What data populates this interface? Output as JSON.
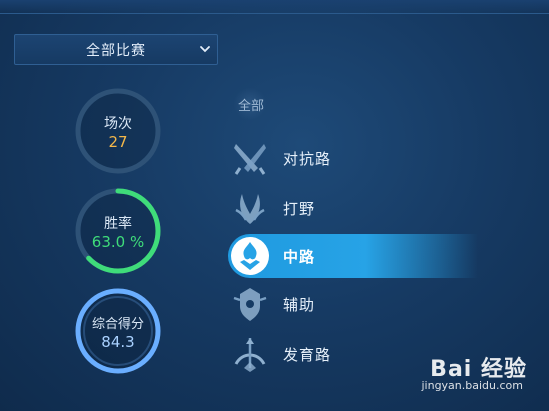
{
  "colors": {
    "accent_blue": "#27a3e6",
    "win_green": "#3fdc7a",
    "matches_orange": "#f3b74a",
    "score_blue": "#6aaeff",
    "text": "#e6f0fa"
  },
  "filter": {
    "selected": "全部比赛"
  },
  "stats": {
    "matches": {
      "label": "场次",
      "value": "27"
    },
    "win_rate": {
      "label": "胜率",
      "value": "63.0 %",
      "fraction": 0.63
    },
    "score": {
      "label": "综合得分",
      "value": "84.3"
    }
  },
  "roles": {
    "all_label": "全部",
    "items": [
      {
        "label": "对抗路",
        "icon": "crossed-swords-icon"
      },
      {
        "label": "打野",
        "icon": "claw-leaf-icon"
      },
      {
        "label": "中路",
        "icon": "flame-crystal-icon",
        "active": true
      },
      {
        "label": "辅助",
        "icon": "shield-helmet-icon"
      },
      {
        "label": "发育路",
        "icon": "bow-arrow-icon"
      }
    ]
  },
  "watermark": {
    "brand": "Bai 经验",
    "url": "jingyan.baidu.com"
  }
}
